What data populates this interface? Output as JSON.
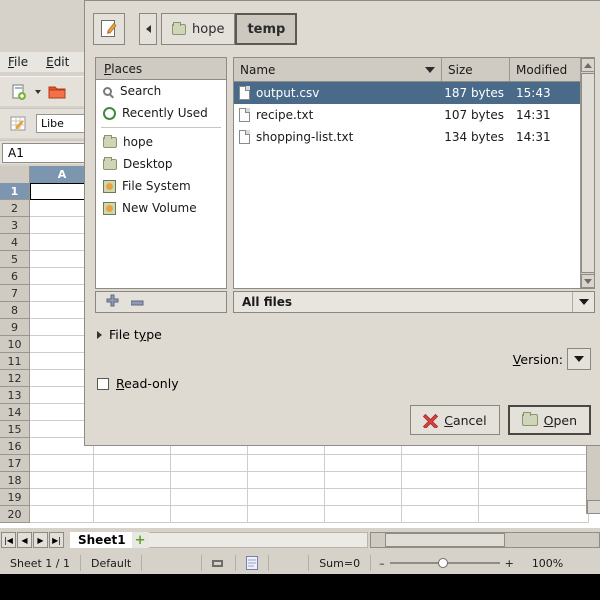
{
  "app": {
    "menus": [
      "File",
      "Edit"
    ],
    "name_box": "A1",
    "font_name": "Libe",
    "columns": [
      "A"
    ],
    "rows": [
      "1",
      "2",
      "3",
      "4",
      "5",
      "6",
      "7",
      "8",
      "9",
      "10",
      "11",
      "12",
      "13",
      "14",
      "15",
      "16",
      "17",
      "18",
      "19",
      "20"
    ],
    "sheet_tab": "Sheet1",
    "add_sheet_label": "+",
    "status": {
      "sheet_count": "Sheet 1 / 1",
      "page_style": "Default",
      "sum": "Sum=0",
      "zoom_minus": "–",
      "zoom_plus": "+",
      "zoom_level": "100%"
    }
  },
  "dialog": {
    "edit_icon": "pencil-document-icon",
    "nav_back": "◀",
    "breadcrumbs": [
      {
        "label": "hope",
        "icon": "folder-icon",
        "active": false
      },
      {
        "label": "temp",
        "icon": "",
        "active": true
      }
    ],
    "places": {
      "header": "Places",
      "items": [
        {
          "label": "Search",
          "icon": "magnifier-icon"
        },
        {
          "label": "Recently Used",
          "icon": "clock-icon"
        },
        {
          "label": "hope",
          "icon": "folder-icon"
        },
        {
          "label": "Desktop",
          "icon": "folder-icon"
        },
        {
          "label": "File System",
          "icon": "drive-icon"
        },
        {
          "label": "New Volume",
          "icon": "drive-icon"
        }
      ],
      "add_label": "+",
      "remove_label": "–"
    },
    "filelist": {
      "columns": [
        "Name",
        "Size",
        "Modified"
      ],
      "rows": [
        {
          "name": "output.csv",
          "size": "187 bytes",
          "modified": "15:43",
          "selected": true
        },
        {
          "name": "recipe.txt",
          "size": "107 bytes",
          "modified": "14:31",
          "selected": false
        },
        {
          "name": "shopping-list.txt",
          "size": "134 bytes",
          "modified": "14:31",
          "selected": false
        }
      ]
    },
    "filter": "All files",
    "file_type_label": "File type",
    "version_label": "Version:",
    "readonly_label": "Read-only",
    "cancel_label": "Cancel",
    "open_label": "Open",
    "selection_color": "#4a6a8a"
  }
}
